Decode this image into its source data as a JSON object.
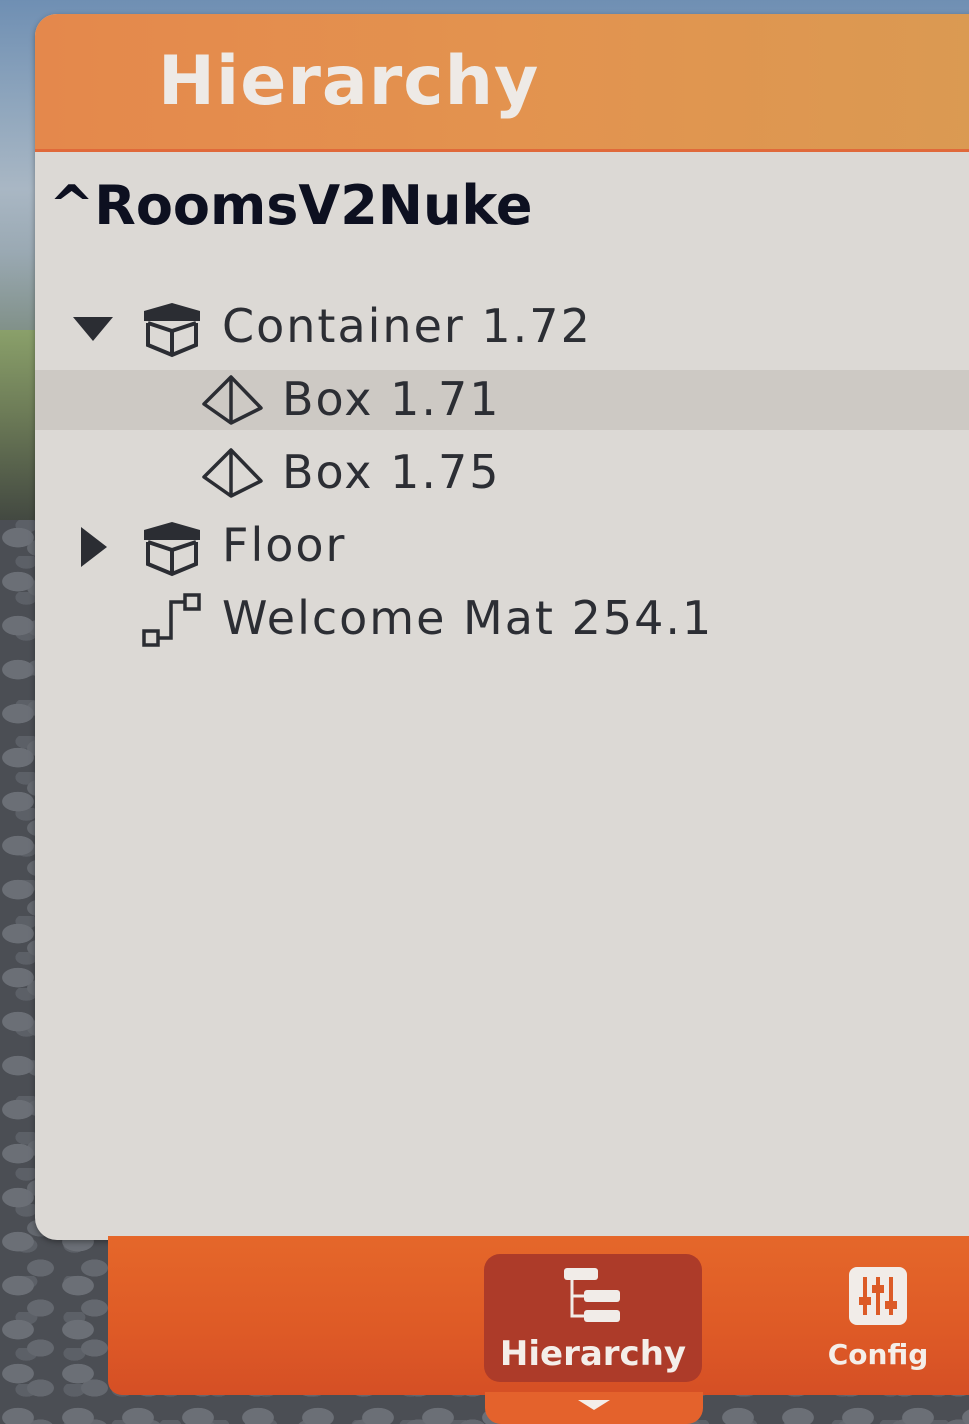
{
  "panel": {
    "title": "Hierarchy",
    "world_name": "^RoomsV2Nuke"
  },
  "tree": {
    "items": [
      {
        "label": "Container 1.72",
        "icon": "container-box-icon",
        "expander": "expanded"
      },
      {
        "label": "Box 1.71",
        "icon": "pyramid-shape-icon",
        "selected": true
      },
      {
        "label": "Box 1.75",
        "icon": "pyramid-shape-icon"
      },
      {
        "label": "Floor",
        "icon": "container-box-icon",
        "expander": "collapsed"
      },
      {
        "label": "Welcome Mat 254.1",
        "icon": "path-nodes-icon"
      }
    ]
  },
  "toolbar": {
    "tabs": [
      {
        "label": "Hierarchy",
        "icon": "hierarchy-icon",
        "active": true
      },
      {
        "label": "Config",
        "icon": "sliders-icon",
        "active": false
      }
    ]
  },
  "colors": {
    "header_orange": "#e3934f",
    "toolbar_orange": "#e5672a",
    "active_tab": "#ad3b29",
    "panel_bg": "#dcd9d5",
    "selected_row": "#cdc9c4"
  }
}
